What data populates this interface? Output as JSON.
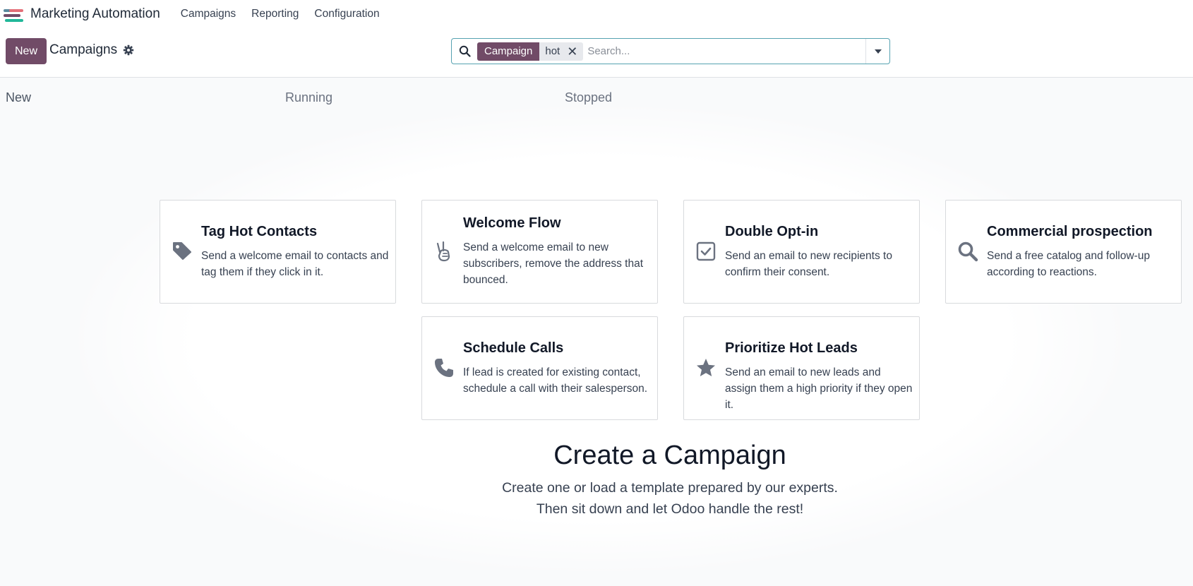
{
  "app": {
    "title": "Marketing Automation",
    "brand_colors": [
      "#e46f78",
      "#21b799",
      "#5b899e",
      "#714b67"
    ]
  },
  "nav": {
    "items": [
      "Campaigns",
      "Reporting",
      "Configuration"
    ]
  },
  "control_panel": {
    "new_label": "New",
    "breadcrumb": "Campaigns",
    "gear_icon": "gear-icon"
  },
  "search": {
    "facet_label": "Campaign",
    "facet_value": "hot",
    "placeholder": "Search...",
    "value": ""
  },
  "columns": [
    "New",
    "Running",
    "Stopped"
  ],
  "templates": [
    {
      "title": "Tag Hot Contacts",
      "description": "Send a welcome email to contacts and tag them if they click in it.",
      "icon": "tag-icon"
    },
    {
      "title": "Welcome Flow",
      "description": "Send a welcome email to new subscribers, remove the address that bounced.",
      "icon": "hand-peace-icon"
    },
    {
      "title": "Double Opt-in",
      "description": "Send an email to new recipients to confirm their consent.",
      "icon": "check-square-icon"
    },
    {
      "title": "Commercial prospection",
      "description": "Send a free catalog and follow-up according to reactions.",
      "icon": "search-icon"
    },
    {
      "title": "Schedule Calls",
      "description": "If lead is created for existing contact, schedule a call with their salesperson.",
      "icon": "phone-icon"
    },
    {
      "title": "Prioritize Hot Leads",
      "description": "Send an email to new leads and assign them a high priority if they open it.",
      "icon": "star-icon"
    }
  ],
  "helper": {
    "title": "Create a Campaign",
    "line1": "Create one or load a template prepared by our experts.",
    "line2": "Then sit down and let Odoo handle the rest!"
  },
  "colors": {
    "primary": "#714b67",
    "search_border": "#56a2b1",
    "facet_bg": "#e7e9ed"
  }
}
